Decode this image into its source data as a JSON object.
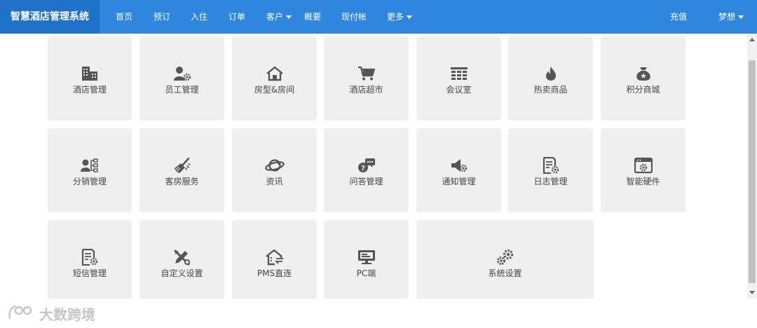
{
  "app": {
    "title": "智慧酒店管理系统"
  },
  "nav": {
    "items": [
      {
        "label": "首页"
      },
      {
        "label": "预订"
      },
      {
        "label": "入住"
      },
      {
        "label": "订单"
      },
      {
        "label": "客户"
      },
      {
        "label": "概要"
      },
      {
        "label": "现付帐"
      },
      {
        "label": "更多"
      }
    ],
    "recharge": "充值",
    "user": "梦想"
  },
  "tiles": [
    {
      "label": "酒店管理",
      "icon": "building-icon"
    },
    {
      "label": "员工管理",
      "icon": "staff-gear-icon"
    },
    {
      "label": "房型&房间",
      "icon": "house-icon"
    },
    {
      "label": "酒店超市",
      "icon": "cart-icon"
    },
    {
      "label": "会议室",
      "icon": "meeting-grid-icon"
    },
    {
      "label": "热卖商品",
      "icon": "fire-icon"
    },
    {
      "label": "积分商城",
      "icon": "money-bag-icon"
    },
    {
      "label": "分销管理",
      "icon": "distribution-icon"
    },
    {
      "label": "客房服务",
      "icon": "broom-icon"
    },
    {
      "label": "资讯",
      "icon": "planet-icon"
    },
    {
      "label": "问答管理",
      "icon": "qa-chat-icon"
    },
    {
      "label": "通知管理",
      "icon": "megaphone-gear-icon"
    },
    {
      "label": "日志管理",
      "icon": "log-gear-icon"
    },
    {
      "label": "智能硬件",
      "icon": "hardware-gear-icon"
    },
    {
      "label": "短信管理",
      "icon": "sms-doc-gear-icon"
    },
    {
      "label": "自定义设置",
      "icon": "pencil-wrench-icon"
    },
    {
      "label": "PMS直连",
      "icon": "pms-house-icon"
    },
    {
      "label": "PC端",
      "icon": "monitor-icon"
    },
    {
      "label": "系统设置",
      "icon": "gears-icon"
    }
  ],
  "watermark": {
    "text": "大数跨境"
  },
  "colors": {
    "topbar": "#2e86de",
    "brand": "#1f72c8",
    "tile": "#efefef",
    "icon": "#555555"
  }
}
